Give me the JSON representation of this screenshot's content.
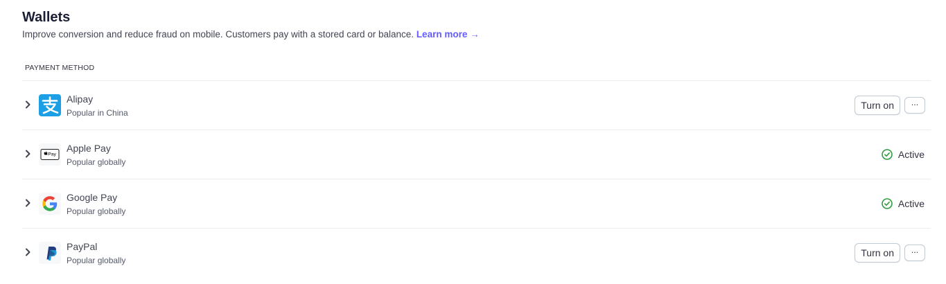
{
  "header": {
    "title": "Wallets",
    "subtitle": "Improve conversion and reduce fraud on mobile. Customers pay with a stored card or balance.",
    "learn_more": "Learn more →"
  },
  "table": {
    "column_header": "PAYMENT METHOD"
  },
  "methods": [
    {
      "name": "Alipay",
      "description": "Popular in China",
      "state": "off",
      "action_label": "Turn on",
      "more_label": "···",
      "icon": "alipay-logo-icon"
    },
    {
      "name": "Apple Pay",
      "description": "Popular globally",
      "state": "active",
      "status_label": "Active",
      "icon": "apple-pay-logo-icon",
      "logo_text": "Pay"
    },
    {
      "name": "Google Pay",
      "description": "Popular globally",
      "state": "active",
      "status_label": "Active",
      "icon": "google-logo-icon"
    },
    {
      "name": "PayPal",
      "description": "Popular globally",
      "state": "off",
      "action_label": "Turn on",
      "more_label": "···",
      "icon": "paypal-logo-icon"
    }
  ],
  "colors": {
    "accent": "#635bff",
    "active_green": "#2e9c3e",
    "alipay_blue": "#1c9fe5",
    "paypal_dark": "#253b80",
    "paypal_light": "#179bd7"
  }
}
